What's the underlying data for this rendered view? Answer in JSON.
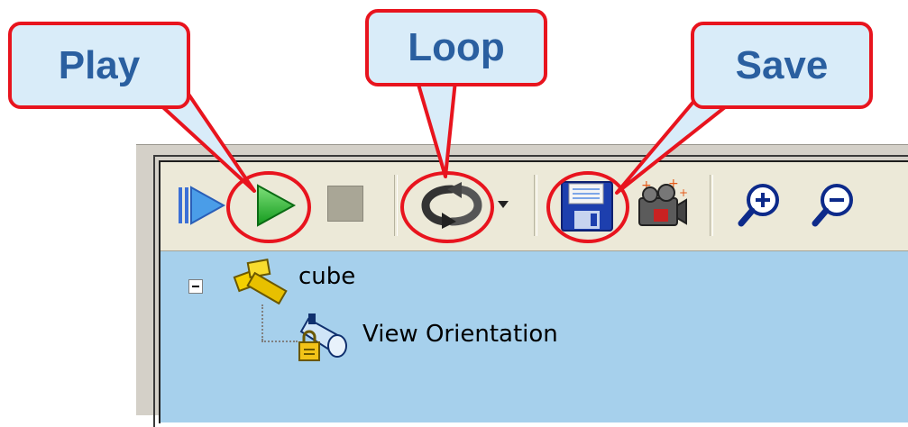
{
  "callouts": [
    {
      "label": "Play"
    },
    {
      "label": "Loop"
    },
    {
      "label": "Save"
    }
  ],
  "toolbar": {
    "buttons": [
      {
        "icon": "step-play-icon"
      },
      {
        "icon": "play-icon"
      },
      {
        "icon": "stop-icon"
      },
      {
        "icon": "loop-icon"
      },
      {
        "icon": "dropdown-arrow-icon"
      },
      {
        "icon": "save-icon"
      },
      {
        "icon": "record-camera-icon"
      },
      {
        "icon": "zoom-in-icon"
      },
      {
        "icon": "zoom-out-icon"
      }
    ]
  },
  "tree": {
    "root_label": "cube",
    "child_label": "View Orientation"
  },
  "colors": {
    "callout_border": "#e8141e",
    "callout_fill": "#d9ecf9",
    "callout_text": "#2a5fa0",
    "tree_background": "#a6d0ec",
    "toolbar_background": "#ece9d8"
  }
}
